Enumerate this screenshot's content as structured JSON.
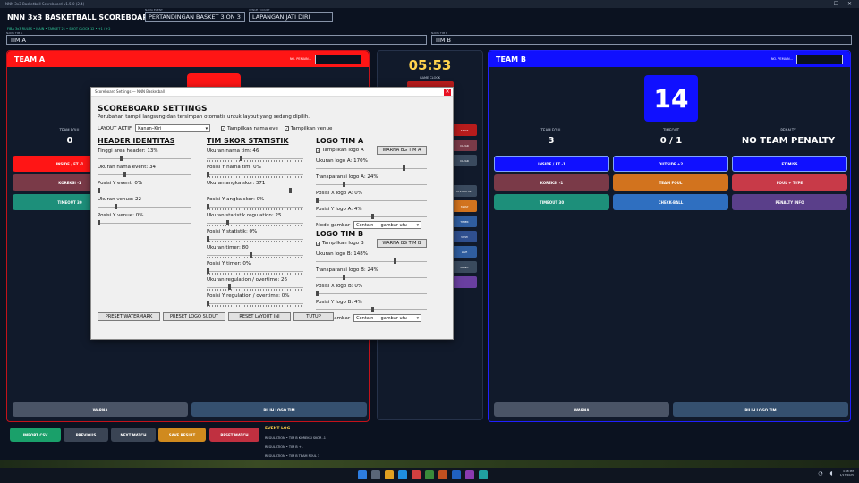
{
  "window": {
    "title": "NNN 3x3 Basketball Scoreboard v1.5.0 (2.4)",
    "controls": [
      "—",
      "☐",
      "✕"
    ]
  },
  "header": {
    "app_title": "NNN 3x3 BASKETBALL SCOREBOARD",
    "rules": "FIBA 3x3 RULES • MAIN • TARGET 21 • SHOT CLOCK 12 • +1 / +2",
    "event_label": "NAMA EVENT",
    "event_value": "PERTANDINGAN BASKET 3 ON 3",
    "venue_label": "VENUE / COURT",
    "venue_value": "LAPANGAN JATI DIRI",
    "team_a_label": "NAMA TIM A",
    "team_a_value": "TIM A",
    "team_b_label": "NAMA TIM B",
    "team_b_value": "TIM B"
  },
  "team_a": {
    "name": "TEAM A",
    "pemain_label": "NO. PEMAIN...",
    "foul_label": "TEAM FOUL",
    "foul_value": "0",
    "buttons": {
      "inside": "INSIDE / FT -1",
      "koreksi": "KOREKSI -1",
      "timeout": "TIMEOUT 30",
      "warna": "WARNA",
      "logo": "PILIH LOGO TIM"
    },
    "colors": {
      "primary": "#ff1515"
    }
  },
  "team_b": {
    "name": "TEAM B",
    "pemain_label": "NO. PEMAIN...",
    "score": "14",
    "foul_label": "TEAM FOUL",
    "foul_value": "3",
    "timeout_label": "TIMEOUT",
    "timeout_value": "0 / 1",
    "penalty_label": "PENALTY",
    "penalty_value": "NO TEAM PENALTY",
    "buttons": {
      "inside": "INSIDE / FT -1",
      "outside": "OUTSIDE +2",
      "ft_miss": "FT MISS",
      "koreksi": "KOREKSI -1",
      "team_foul": "TEAM FOUL",
      "foul_type": "FOUL + TYPE",
      "timeout": "TIMEOUT 30",
      "check_ball": "CHECK-BALL",
      "penalty_info": "PENALTY INFO",
      "warna": "WARNA",
      "logo": "PILIH LOGO TIM"
    },
    "colors": {
      "primary": "#1010ff"
    }
  },
  "middle": {
    "clock": "05:53",
    "game_clock_label": "GAME CLOCK",
    "buttons": [
      "SHOT",
      "CLEAR",
      "SYSTEM 3x3",
      "SWAP",
      "TIMER",
      "VIEW",
      "LIVE",
      "MENU"
    ]
  },
  "bottom": {
    "import_csv": "IMPORT CSV",
    "previous": "PREVIOUS",
    "next_match": "NEXT MATCH",
    "save_result": "SAVE RESULT",
    "reset_match": "RESET MATCH",
    "event_log_title": "EVENT LOG",
    "event_log": [
      "REGULATION • TIM B KOREKSI SKOR -1",
      "REGULATION • TIM B +1",
      "REGULATION • TIM B TEAM FOUL 3"
    ]
  },
  "dialog": {
    "title": "Scoreboard Settings — NNN Basketball",
    "heading": "SCOREBOARD SETTINGS",
    "description": "Perubahan tampil langsung dan tersimpan otomatis untuk layout yang sedang dipilih.",
    "layout_label": "LAYOUT AKTIF",
    "layout_value": "Kanan–Kiri",
    "show_event_label": "Tampilkan nama eve",
    "show_venue_label": "Tampilkan venue",
    "sections": {
      "header": {
        "title": "HEADER  IDENTITAS",
        "fields": [
          {
            "label": "Tinggi area header: 13%",
            "value": 13
          },
          {
            "label": "Ukuran nama event: 34",
            "value": 34
          },
          {
            "label": "Posisi Y event: 0%",
            "value": 0
          },
          {
            "label": "Ukuran venue: 22",
            "value": 22
          },
          {
            "label": "Posisi Y venue: 0%",
            "value": 0
          }
        ]
      },
      "tim": {
        "title": "TIM  SKOR  STATISTIK",
        "fields": [
          {
            "label": "Ukuran nama tim: 46",
            "value": 46
          },
          {
            "label": "Posisi Y nama tim: 0%",
            "value": 0
          },
          {
            "label": "Ukuran angka skor: 371",
            "value": 371
          },
          {
            "label": "Posisi Y angka skor: 0%",
            "value": 0
          },
          {
            "label": "Ukuran statistik regulation: 25",
            "value": 25
          },
          {
            "label": "Posisi Y statistik: 0%",
            "value": 0
          },
          {
            "label": "Ukuran timer: 80",
            "value": 80
          },
          {
            "label": "Posisi Y timer: 0%",
            "value": 0
          },
          {
            "label": "Ukuran regulation / overtime: 26",
            "value": 26
          },
          {
            "label": "Posisi Y regulation / overtime: 0%",
            "value": 0
          }
        ]
      },
      "logo_a": {
        "title": "LOGO TIM A",
        "show_label": "Tampilkan logo A",
        "color_btn": "WARNA BG TIM A",
        "fields": [
          {
            "label": "Ukuran logo A: 170%",
            "value": 170
          },
          {
            "label": "Transparansi logo A: 24%",
            "value": 24
          },
          {
            "label": "Posisi X logo A: 0%",
            "value": 0
          },
          {
            "label": "Posisi Y logo A: 4%",
            "value": 4
          }
        ],
        "mode_label": "Mode gambar",
        "mode_value": "Contain — gambar utu"
      },
      "logo_b": {
        "title": "LOGO TIM B",
        "show_label": "Tampilkan logo B",
        "color_btn": "WARNA BG TIM B",
        "fields": [
          {
            "label": "Ukuran logo B: 148%",
            "value": 148
          },
          {
            "label": "Transparansi logo B: 24%",
            "value": 24
          },
          {
            "label": "Posisi X logo B: 0%",
            "value": 0
          },
          {
            "label": "Posisi Y logo B: 4%",
            "value": 4
          }
        ],
        "mode_label": "Mode gambar",
        "mode_value": "Contain — gambar utu"
      }
    },
    "buttons": {
      "preset_watermark": "PRESET WATERMARK",
      "preset_logo": "PRESET LOGO SUDUT",
      "reset_layout": "RESET LAYOUT INI",
      "tutup": "TUTUP"
    }
  },
  "taskbar": {
    "clock": "4:48 PM",
    "date": "1/17/2025"
  }
}
